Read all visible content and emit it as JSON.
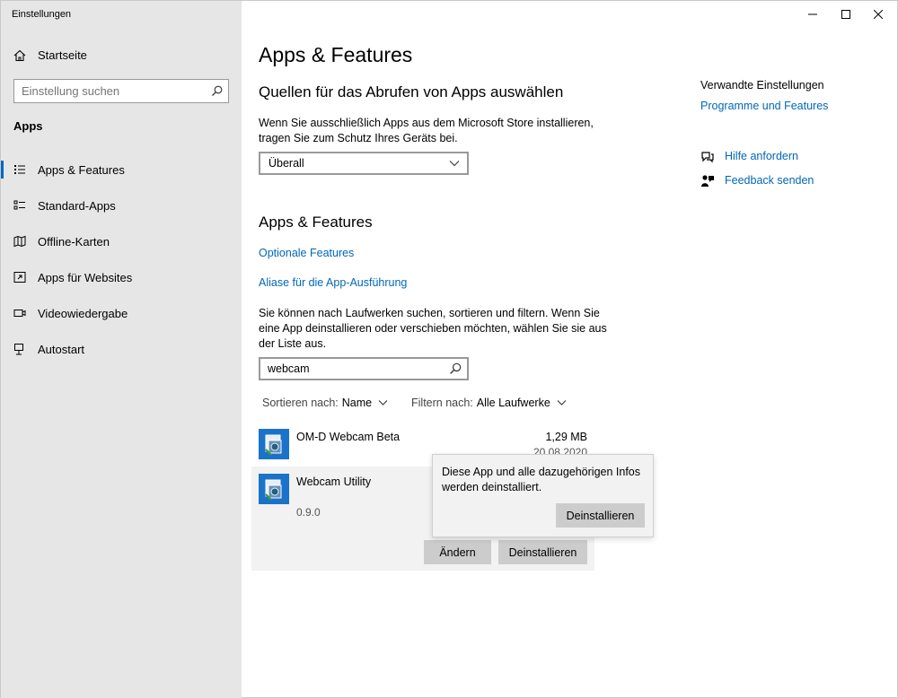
{
  "window": {
    "title": "Einstellungen",
    "controls": [
      "minimize",
      "maximize",
      "close"
    ]
  },
  "sidebar": {
    "home_label": "Startseite",
    "search_placeholder": "Einstellung suchen",
    "section": "Apps",
    "items": [
      {
        "label": "Apps & Features",
        "icon": "apps-features-icon",
        "active": true
      },
      {
        "label": "Standard-Apps",
        "icon": "default-apps-icon",
        "active": false
      },
      {
        "label": "Offline-Karten",
        "icon": "offline-maps-icon",
        "active": false
      },
      {
        "label": "Apps für Websites",
        "icon": "apps-websites-icon",
        "active": false
      },
      {
        "label": "Videowiedergabe",
        "icon": "video-playback-icon",
        "active": false
      },
      {
        "label": "Autostart",
        "icon": "startup-icon",
        "active": false
      }
    ]
  },
  "main": {
    "page_title": "Apps & Features",
    "sources": {
      "heading": "Quellen für das Abrufen von Apps auswählen",
      "description": "Wenn Sie ausschließlich Apps aus dem Microsoft Store installieren, tragen Sie zum Schutz Ihres Geräts bei.",
      "dropdown_value": "Überall"
    },
    "features": {
      "heading": "Apps & Features",
      "link_optional": "Optionale Features",
      "link_aliases": "Aliase für die App-Ausführung",
      "description": "Sie können nach Laufwerken suchen, sortieren und filtern. Wenn Sie eine App deinstallieren oder verschieben möchten, wählen Sie sie aus der Liste aus.",
      "search_value": "webcam",
      "sort_label": "Sortieren nach:",
      "sort_value": "Name",
      "filter_label": "Filtern nach:",
      "filter_value": "Alle Laufwerke"
    },
    "apps": [
      {
        "name": "OM-D Webcam Beta",
        "size": "1,29 MB",
        "date": "20.08.2020"
      },
      {
        "name": "Webcam Utility",
        "version": "0.9.0",
        "modify_label": "Ändern",
        "uninstall_label": "Deinstallieren"
      }
    ],
    "flyout": {
      "message": "Diese App und alle dazugehörigen Infos werden deinstalliert.",
      "button": "Deinstallieren"
    }
  },
  "related": {
    "title": "Verwandte Einstellungen",
    "programs_link": "Programme und Features",
    "help_link": "Hilfe anfordern",
    "feedback_link": "Feedback senden"
  },
  "colors": {
    "accent": "#0067b8",
    "sidebar_bg": "#e6e6e6",
    "button_bg": "#cccccc",
    "selected_row_bg": "#f2f2f2"
  }
}
